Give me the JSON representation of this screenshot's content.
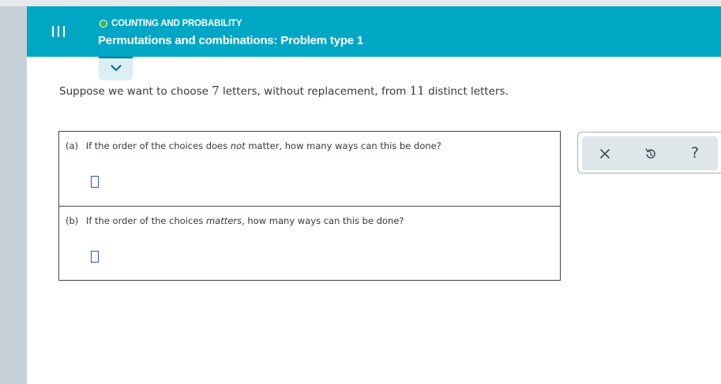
{
  "header": {
    "topic": "COUNTING AND PROBABILITY",
    "title": "Permutations and combinations: Problem type 1"
  },
  "prompt": {
    "pre": "Suppose we want to choose ",
    "k": "7",
    "mid": " letters, without replacement, from ",
    "n": "11",
    "post": " distinct letters."
  },
  "questions": [
    {
      "label": "(a)",
      "pre": "If the order of the choices does ",
      "emph": "not",
      "post": " matter, how many ways can this be done?",
      "answer": ""
    },
    {
      "label": "(b)",
      "pre": "If the order of the choices ",
      "emph": "matters",
      "post": ", how many ways can this be done?",
      "answer": ""
    }
  ],
  "tools": {
    "help_glyph": "?"
  },
  "icons": {
    "menu": "hamburger-menu-icon",
    "topic_status": "green-circle-icon",
    "collapse": "chevron-down-icon",
    "clear": "close-icon",
    "undo": "undo-icon",
    "help": "question-mark-icon"
  },
  "colors": {
    "header_bg": "#00a7c5",
    "topic_dot": "#3cb34a",
    "answer_box_border": "#2b53c9",
    "left_rail": "#c5d0d7",
    "tool_bg": "#dfe6ea"
  }
}
